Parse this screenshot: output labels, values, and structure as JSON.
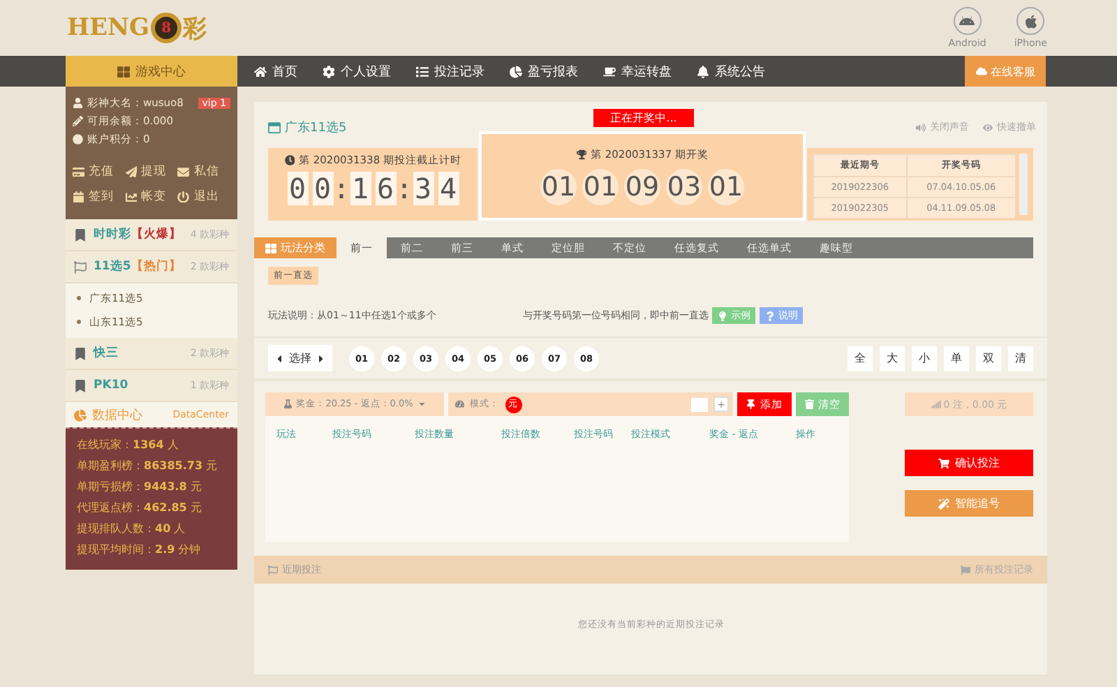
{
  "header": {
    "logo_text": "HENG",
    "logo_badge": "8",
    "logo_tail": "彩",
    "apps": [
      {
        "kind": "android",
        "label": "Android"
      },
      {
        "kind": "apple",
        "label": "iPhone"
      }
    ]
  },
  "nav": {
    "game_center": "游戏中心",
    "items": [
      {
        "label": "首页"
      },
      {
        "label": "个人设置"
      },
      {
        "label": "投注记录"
      },
      {
        "label": "盈亏报表"
      },
      {
        "label": "幸运转盘"
      },
      {
        "label": "系统公告"
      }
    ],
    "service": "在线客服"
  },
  "user": {
    "name": "彩神大名：wusuo8",
    "vip": "vip 1",
    "balance": "可用余额：0.000",
    "points": "账户积分：0",
    "actions": [
      {
        "label": "充值"
      },
      {
        "label": "提现"
      },
      {
        "label": "私信"
      },
      {
        "label": "签到"
      },
      {
        "label": "帐变"
      },
      {
        "label": "退出"
      }
    ]
  },
  "games": [
    {
      "name": "时时彩",
      "tag": "【火爆】",
      "count": "4 款彩种",
      "expanded": false
    },
    {
      "name": "11选5",
      "tag": "【热门】",
      "count": "2 款彩种",
      "expanded": true,
      "children": [
        {
          "name": "广东11选5"
        },
        {
          "name": "山东11选5"
        }
      ]
    },
    {
      "name": "快三",
      "count": "2 款彩种",
      "expanded": false
    },
    {
      "name": "PK10",
      "count": "1 款彩种",
      "expanded": false
    }
  ],
  "data_center": {
    "title": "数据中心",
    "subtitle": "DataCenter",
    "stats": [
      {
        "label": "在线玩家：",
        "value": "1364",
        "unit": "人"
      },
      {
        "label": "单期盈利榜：",
        "value": "86385.73",
        "unit": "元"
      },
      {
        "label": "单期亏损榜：",
        "value": "9443.8",
        "unit": "元"
      },
      {
        "label": "代理返点榜：",
        "value": "462.85",
        "unit": "元"
      },
      {
        "label": "提现排队人数：",
        "value": "40",
        "unit": "人"
      },
      {
        "label": "提现平均时间：",
        "value": "2.9",
        "unit": "分钟"
      }
    ]
  },
  "lottery": {
    "title": "广东11选5",
    "drawing_status": "正在开奖中...",
    "links": [
      {
        "label": "关闭声音"
      },
      {
        "label": "快速撤单"
      }
    ],
    "countdown": {
      "caption": "第 2020031338 期投注截止计时",
      "digits": [
        "0",
        "0",
        ":",
        "1",
        "6",
        ":",
        "3",
        "4"
      ]
    },
    "draw": {
      "caption": "第 2020031337 期开奖",
      "balls": [
        "01",
        "01",
        "09",
        "03",
        "01"
      ]
    },
    "history": {
      "columns": [
        "最近期号",
        "开奖号码"
      ],
      "rows": [
        [
          "2019022306",
          "07.04.10.05.06"
        ],
        [
          "2019022305",
          "04.11.09.05.08"
        ]
      ]
    }
  },
  "play_tabs": {
    "category": "玩法分类",
    "tabs": [
      {
        "label": "前一",
        "selected": true
      },
      {
        "label": "前二",
        "selected": false
      },
      {
        "label": "前三",
        "selected": false
      },
      {
        "label": "单式",
        "selected": false
      },
      {
        "label": "定位胆",
        "selected": false
      },
      {
        "label": "不定位",
        "selected": false
      },
      {
        "label": "任选复式",
        "selected": false
      },
      {
        "label": "任选单式",
        "selected": false
      },
      {
        "label": "趣味型",
        "selected": false
      }
    ],
    "sub_tabs": [
      {
        "label": "前一直选",
        "selected": true
      }
    ]
  },
  "rule": {
    "left": "玩法说明：从01～11中任选1个或多个",
    "right": "与开奖号码第一位号码相同，即中前一直选",
    "example": "示例",
    "help": "说明"
  },
  "picker": {
    "label": "选择",
    "numbers": [
      "01",
      "02",
      "03",
      "04",
      "05",
      "06",
      "07",
      "08"
    ],
    "filters": [
      "全",
      "大",
      "小",
      "单",
      "双",
      "清"
    ]
  },
  "bet": {
    "prize": "奖金：20.25 - 返点：0.0%",
    "mode_label": "模式：",
    "mode": "元",
    "plus": "+",
    "add": "添加",
    "clear": "清空",
    "columns": [
      "玩法",
      "投注号码",
      "投注数量",
      "投注倍数",
      "投注号码",
      "投注模式",
      "奖金 - 返点",
      "操作"
    ],
    "summary": "0 注，0.00 元",
    "confirm": "确认投注",
    "chase": "智能追号"
  },
  "recent": {
    "title": "近期投注",
    "all": "所有投注记录",
    "empty": "您还没有当前彩种的近期投注记录"
  }
}
